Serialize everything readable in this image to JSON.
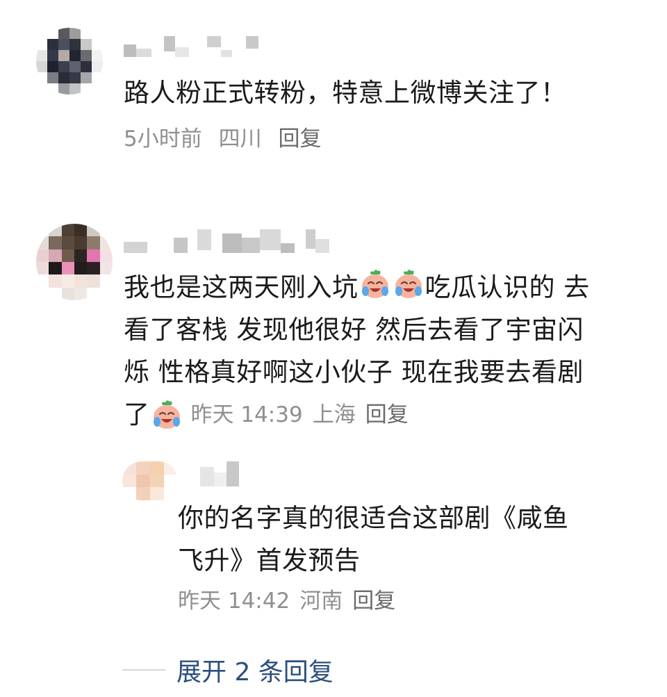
{
  "comments": [
    {
      "text": "路人粉正式转粉，特意上微博关注了！",
      "time": "5小时前",
      "location": "四川",
      "reply_label": "回复"
    },
    {
      "text_line1_a": "我也是这两天刚入坑",
      "text_line1_b": "吃瓜认识的 去",
      "text_line2": "看了客栈 发现他很好 然后去看了宇宙闪",
      "text_line3": "烁 性格真好啊这小伙子 现在我要去看剧",
      "text_line4": "了",
      "time": "昨天 14:39",
      "location": "上海",
      "reply_label": "回复",
      "emoji_icon": "crying-laughing-emoji",
      "reply": {
        "text_line1": "你的名字真的很适合这部剧《咸鱼",
        "text_line2": "飞升》首发预告",
        "time": "昨天 14:42",
        "location": "河南",
        "reply_label": "回复"
      }
    }
  ],
  "expand_replies_label": "展开 2 条回复",
  "colors": {
    "text": "#1a1a1a",
    "meta": "#8f8f8f",
    "link": "#2b4f7c"
  }
}
